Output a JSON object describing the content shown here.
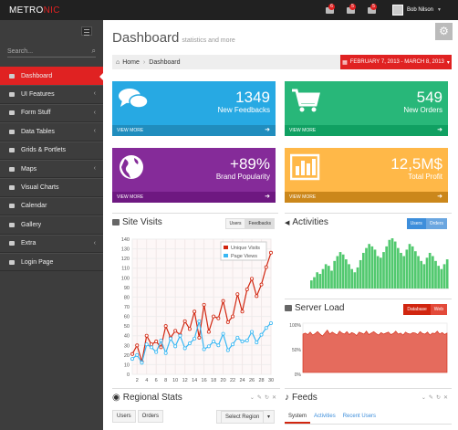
{
  "logo": {
    "a": "METRO",
    "b": "NIC"
  },
  "header": {
    "notif": [
      "6",
      "5",
      "5"
    ],
    "user": "Bob Nilson"
  },
  "sidebar": {
    "search_placeholder": "Search...",
    "items": [
      {
        "label": "Dashboard",
        "active": true,
        "arrow": false
      },
      {
        "label": "UI Features",
        "arrow": true
      },
      {
        "label": "Form Stuff",
        "arrow": true
      },
      {
        "label": "Data Tables",
        "arrow": true
      },
      {
        "label": "Grids & Portlets",
        "arrow": false
      },
      {
        "label": "Maps",
        "arrow": true
      },
      {
        "label": "Visual Charts",
        "arrow": false
      },
      {
        "label": "Calendar",
        "arrow": false
      },
      {
        "label": "Gallery",
        "arrow": false
      },
      {
        "label": "Extra",
        "arrow": true
      },
      {
        "label": "Login Page",
        "arrow": false
      }
    ]
  },
  "page": {
    "title": "Dashboard",
    "subtitle": "statistics and more"
  },
  "breadcrumb": {
    "home": "Home",
    "current": "Dashboard",
    "date_range": "FEBRUARY 7, 2013 - MARCH 8, 2013"
  },
  "tiles": [
    {
      "number": "1349",
      "label": "New Feedbacks",
      "more": "VIEW MORE",
      "color": "#27a9e3",
      "dark": "#208dbe",
      "icon": "comments-icon"
    },
    {
      "number": "549",
      "label": "New Orders",
      "more": "VIEW MORE",
      "color": "#28b779",
      "dark": "#10a062",
      "icon": "cart-icon"
    },
    {
      "number": "+89%",
      "label": "Brand Popularity",
      "more": "VIEW MORE",
      "color": "#852b99",
      "dark": "#6e1881",
      "icon": "globe-icon"
    },
    {
      "number": "12,5M$",
      "label": "Total Profit",
      "more": "VIEW MORE",
      "color": "#ffb848",
      "dark": "#cb871b",
      "icon": "bar-chart-icon"
    }
  ],
  "site_visits": {
    "title": "Site Visits",
    "btn_users": "Users",
    "btn_feedbacks": "Feedbacks"
  },
  "activities": {
    "title": "Activities",
    "btn_users": "Users",
    "btn_orders": "Orders"
  },
  "server_load": {
    "title": "Server Load",
    "btn_db": "Database",
    "btn_web": "Web",
    "ticks": [
      "100%",
      "50%",
      "0%"
    ]
  },
  "regional": {
    "title": "Regional Stats",
    "tab_users": "Users",
    "tab_orders": "Orders",
    "select": "Select Region"
  },
  "feeds": {
    "title": "Feeds",
    "tabs": [
      "System",
      "Activities",
      "Recent Users"
    ]
  },
  "chart_data": [
    {
      "type": "line",
      "title": "Site Visits",
      "x": [
        1,
        2,
        3,
        4,
        5,
        6,
        7,
        8,
        9,
        10,
        11,
        12,
        13,
        14,
        15,
        16,
        17,
        18,
        19,
        20,
        21,
        22,
        23,
        24,
        25,
        26,
        27,
        28,
        29,
        30
      ],
      "ylim": [
        0,
        140
      ],
      "yticks": [
        0,
        10,
        20,
        30,
        40,
        50,
        60,
        70,
        80,
        90,
        100,
        110,
        120,
        130,
        140
      ],
      "xticks": [
        2,
        4,
        6,
        8,
        10,
        12,
        14,
        16,
        18,
        20,
        22,
        24,
        26,
        28,
        30
      ],
      "series": [
        {
          "name": "Unique Visits",
          "color": "#d12610",
          "values": [
            21,
            30,
            13,
            40,
            31,
            34,
            28,
            50,
            38,
            45,
            41,
            55,
            47,
            65,
            38,
            72,
            44,
            60,
            58,
            76,
            54,
            60,
            83,
            65,
            88,
            99,
            81,
            93,
            111,
            126
          ]
        },
        {
          "name": "Page Views",
          "color": "#37b7f3",
          "values": [
            16,
            20,
            12,
            31,
            28,
            23,
            35,
            22,
            37,
            29,
            40,
            27,
            32,
            37,
            55,
            26,
            29,
            34,
            30,
            42,
            25,
            31,
            38,
            34,
            35,
            44,
            33,
            41,
            48,
            53
          ]
        }
      ]
    },
    {
      "type": "bar",
      "title": "Activities",
      "values": [
        10,
        14,
        20,
        18,
        24,
        30,
        28,
        22,
        34,
        40,
        45,
        42,
        36,
        30,
        24,
        20,
        26,
        35,
        44,
        50,
        55,
        52,
        48,
        40,
        38,
        45,
        52,
        60,
        62,
        58,
        50,
        44,
        40,
        48,
        55,
        52,
        46,
        40,
        34,
        30,
        38,
        44,
        40,
        34,
        28,
        24,
        30,
        36
      ]
    },
    {
      "type": "area",
      "title": "Server Load",
      "ylim": [
        0,
        100
      ],
      "values": [
        78,
        80,
        77,
        82,
        76,
        79,
        83,
        78,
        74,
        80,
        86,
        78,
        82,
        79,
        76,
        84,
        80,
        78,
        83,
        77,
        81,
        79,
        75,
        82,
        80,
        78,
        84,
        77,
        80,
        83,
        79,
        76,
        81,
        78,
        80,
        82,
        77,
        79,
        84,
        78,
        80,
        76,
        82,
        79,
        78,
        81,
        80,
        77,
        83,
        79,
        78,
        82,
        76,
        80,
        79,
        84,
        78,
        81,
        77,
        80
      ]
    }
  ]
}
